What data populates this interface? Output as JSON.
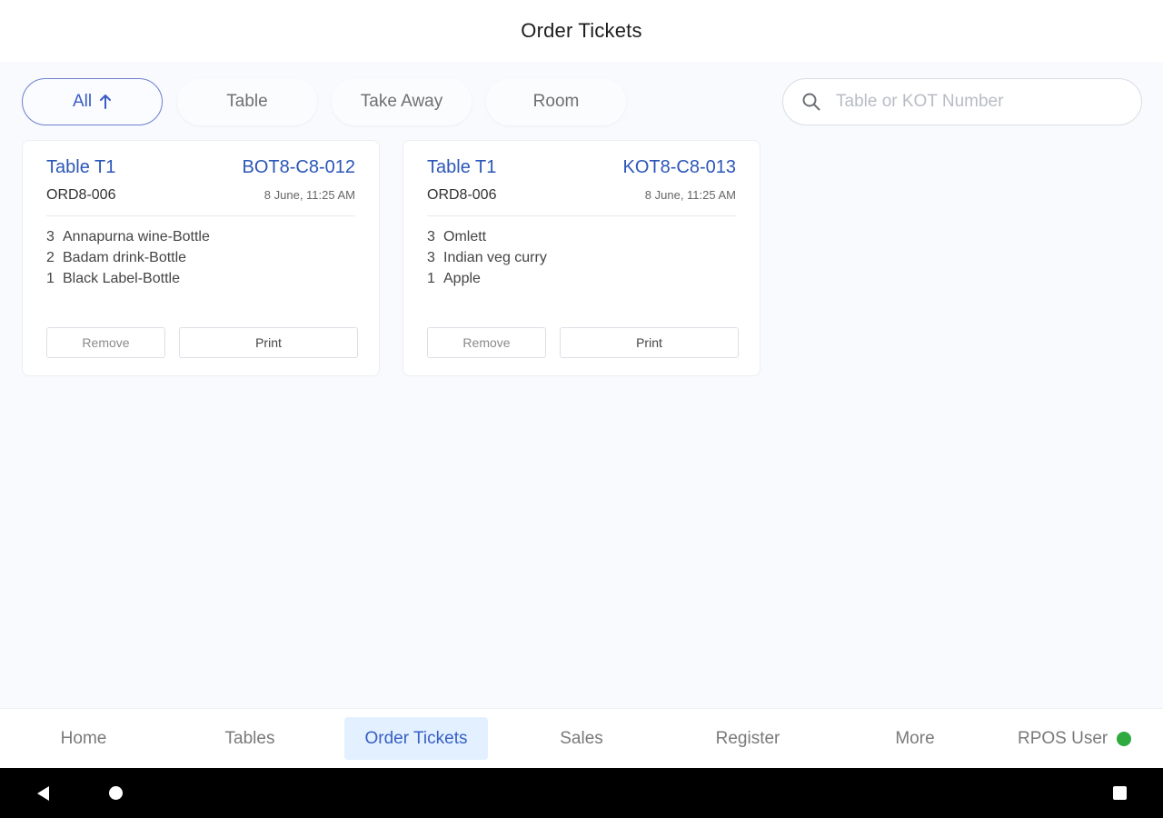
{
  "header": {
    "title": "Order Tickets"
  },
  "filters": {
    "all": "All",
    "table": "Table",
    "take_away": "Take Away",
    "room": "Room"
  },
  "search": {
    "placeholder": "Table or KOT Number",
    "value": ""
  },
  "tickets": [
    {
      "table": "Table T1",
      "kot": "BOT8-C8-012",
      "order": "ORD8-006",
      "time": "8 June, 11:25 AM",
      "items": [
        {
          "qty": "3",
          "name": "Annapurna wine-Bottle"
        },
        {
          "qty": "2",
          "name": "Badam drink-Bottle"
        },
        {
          "qty": "1",
          "name": "Black Label-Bottle"
        }
      ],
      "remove_label": "Remove",
      "print_label": "Print"
    },
    {
      "table": "Table T1",
      "kot": "KOT8-C8-013",
      "order": "ORD8-006",
      "time": "8 June, 11:25 AM",
      "items": [
        {
          "qty": "3",
          "name": "Omlett"
        },
        {
          "qty": "3",
          "name": "Indian veg curry"
        },
        {
          "qty": "1",
          "name": "Apple"
        }
      ],
      "remove_label": "Remove",
      "print_label": "Print"
    }
  ],
  "bottom_nav": {
    "home": "Home",
    "tables": "Tables",
    "order_tickets": "Order Tickets",
    "sales": "Sales",
    "register": "Register",
    "more": "More",
    "user": "RPOS User"
  },
  "colors": {
    "accent": "#2b56b8",
    "active_nav_bg": "#e3f0ff",
    "status_online": "#2eaa3f"
  }
}
